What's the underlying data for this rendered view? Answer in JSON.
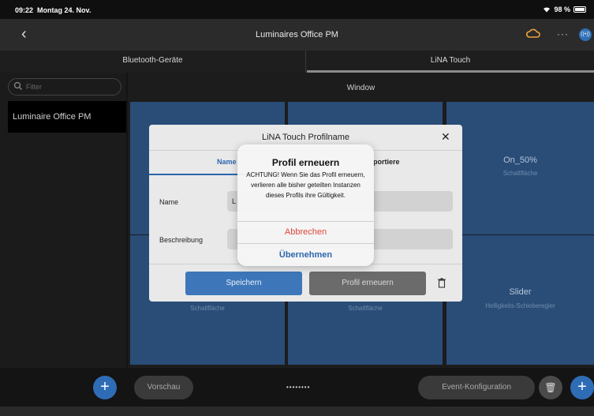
{
  "status": {
    "time": "09:22",
    "date": "Montag 24. Nov.",
    "battery": "98 %"
  },
  "nav": {
    "title": "Luminaires Office PM",
    "back_icon": "chevron-left-icon",
    "more": "···"
  },
  "tabs": [
    {
      "label": "Bluetooth-Geräte"
    },
    {
      "label": "LiNA Touch"
    }
  ],
  "sidebar": {
    "filter_placeholder": "Filter",
    "items": [
      {
        "label": "Luminaire Office PM"
      }
    ]
  },
  "main": {
    "window_label": "Window",
    "tiles": [
      {
        "name": "On_50%",
        "sub": "Schaltfläche"
      },
      {
        "name": "",
        "sub": "Schaltfläche"
      },
      {
        "name": "",
        "sub": "Schaltfläche"
      },
      {
        "name": "Slider",
        "sub": "Helligkeits-Schieberegler"
      }
    ]
  },
  "bottom": {
    "preview": "Vorschau",
    "dots": "••••••••",
    "event": "Event-Konfiguration"
  },
  "dialog": {
    "title": "LiNA Touch Profilname",
    "tab_name": "Name",
    "tab_other": "portiere",
    "name_label": "Name",
    "name_value": "L",
    "desc_label": "Beschreibung",
    "save": "Speichern",
    "renew": "Profil erneuern"
  },
  "alert": {
    "title": "Profil erneuern",
    "message": "ACHTUNG! Wenn Sie das Profil erneuern, verlieren alle bisher geteilten Instanzen dieses Profils ihre Gültigkeit.",
    "cancel": "Abbrechen",
    "confirm": "Übernehmen"
  },
  "colors": {
    "accent": "#2f6cb6",
    "tile": "#2a4d78",
    "danger": "#e0463c"
  }
}
